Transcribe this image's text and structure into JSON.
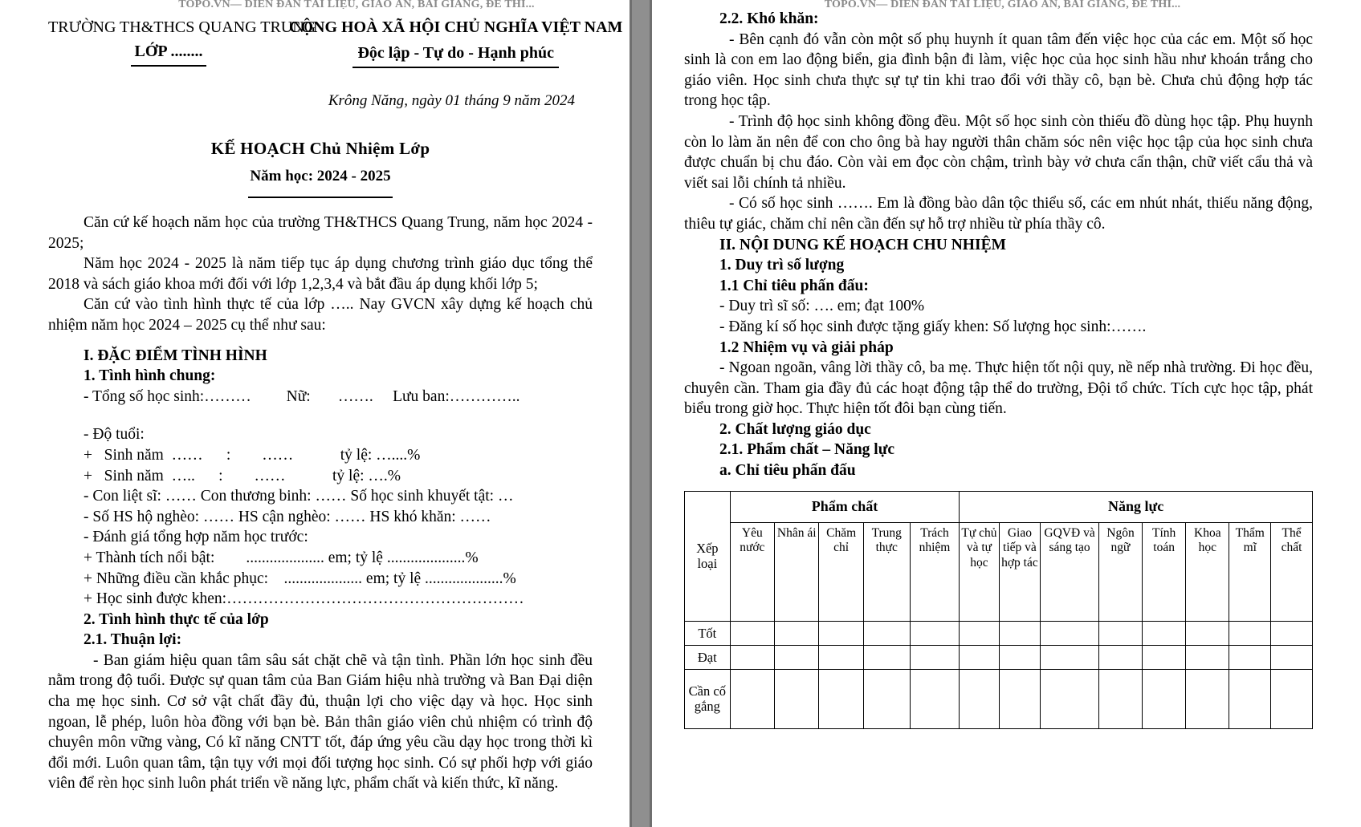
{
  "watermark": "TOPO.VN— DIỄN ĐÀN TÀI LIỆU, GIÁO ÁN, BÀI GIẢNG, ĐỀ THI...",
  "page_left": {
    "header": {
      "school": "TRƯỜNG TH&THCS QUANG TRUNG",
      "class_label": "LỚP ........",
      "national_title": "CỘNG HOÀ XÃ HỘI CHỦ NGHĨA VIỆT NAM",
      "national_motto": "Độc lập - Tự do - Hạnh phúc",
      "place_date": "Krông Năng, ngày 01 tháng 9  năm 2024",
      "doc_title": "KẾ HOẠCH Chủ Nhiệm Lớp",
      "school_year": "Năm học: 2024 - 2025"
    },
    "intro": [
      "Căn cứ kế hoạch năm học của trường TH&THCS Quang Trung, năm học 2024 - 2025;",
      "Năm học 2024 - 2025 là năm tiếp tục áp dụng chương trình giáo dục tổng thể 2018 và sách giáo khoa mới đối với lớp 1,2,3,4 và bắt đầu áp dụng khối lớp 5;",
      "Căn cứ vào tình hình thực tế của lớp ….. Nay GVCN xây dựng kế hoạch chủ nhiệm năm học 2024 – 2025 cụ thể như sau:"
    ],
    "section_1_heading": "I. ĐẶC ĐIỂM TÌNH HÌNH",
    "sub_1_heading": "1. Tình hình chung:",
    "lines": {
      "tong_so": "- Tổng số học sinh:………",
      "nu": "Nữ:",
      "nu_dots": "…….",
      "luu_ban": "Lưu ban:…………..",
      "do_tuoi": "- Độ tuổi:",
      "sinh_nam_1": "+   Sinh năm  ……      :        ……            tỷ lệ: …....%",
      "sinh_nam_2": "+   Sinh năm  …..      :        ……            tỷ lệ: ….%",
      "con_liet_si": "- Con liệt sĩ: ……   Con thương binh: …… Số học sinh khuyết tật: …",
      "ho_ngheo": "- Số HS hộ nghèo: ……         HS cận nghèo: …… HS khó khăn: ……",
      "danh_gia": "- Đánh giá tổng hợp năm học trước:",
      "thanh_tich": "+ Thành tích nổi bật:        .................... em; tỷ lệ ....................%",
      "khac_phuc": "+ Những điều cần khắc phục:    .................... em; tỷ lệ ....................%",
      "duoc_khen": "+ Học sinh được khen:…………………………………………………"
    },
    "sub_2_heading": "2. Tình hình thực tế của lớp",
    "sub_21_heading": "2.1. Thuận lợi:",
    "thuan_loi_text": "- Ban giám hiệu quan tâm sâu sát chặt chẽ và tận tình. Phần lớn học sinh đều nằm trong độ tuổi. Được sự quan tâm của Ban Giám hiệu nhà trường và Ban Đại diện cha mẹ học sinh. Cơ sở vật chất đầy đủ, thuận lợi cho việc dạy và học. Học sinh ngoan, lễ phép, luôn hòa đồng với bạn bè. Bản thân giáo viên chủ nhiệm có trình độ chuyên môn vững vàng, Có kĩ năng CNTT tốt, đáp ứng yêu cầu dạy học trong thời kì đổi mới. Luôn quan tâm, tận tụy với mọi đối tượng học sinh. Có sự phối hợp với giáo viên để rèn học sinh luôn phát triển về năng lực, phẩm chất và kiến thức, kĩ năng."
  },
  "page_right": {
    "sub_22_heading": "2.2. Khó khăn:",
    "kho_khan_1": "- Bên cạnh đó vẫn còn một số  phụ huynh ít quan tâm đến việc học của các em. Một số học sinh là con em lao động biển, gia đình bận đi làm, việc học của học sinh hầu như khoán trắng cho giáo viên. Học sinh chưa thực sự tự tin khi trao đổi với thầy cô, bạn bè. Chưa chủ động hợp tác trong học tập.",
    "kho_khan_2": "- Trình độ học sinh không đồng đều. Một số học sinh còn thiếu đồ dùng học tập. Phụ huynh còn lo làm ăn nên để con cho ông bà hay người thân chăm sóc nên việc học tập của học sinh chưa được chuẩn bị chu đáo. Còn vài em đọc còn chậm, trình bày vở chưa cẩn thận, chữ viết cẩu thả và viết sai lỗi chính tả nhiều.",
    "kho_khan_3": "- Có số học sinh ……. Em là đồng bào dân tộc thiểu số, các em nhút nhát, thiếu năng động, thiêu tự giác, chăm chỉ nên cần đến sự hỗ trợ nhiều từ phía thầy cô.",
    "section_2_heading": "II. NỘI DUNG KẾ HOẠCH CHU NHIỆM",
    "h_1": "1. Duy trì số lượng",
    "h_11": "1.1 Chỉ tiêu phấn đấu:",
    "duy_tri": "- Duy trì sĩ số:  …. em; đạt 100%",
    "dang_ki": "- Đăng kí số học sinh được tặng giấy khen: Số lượng học sinh:…….",
    "h_12": "1.2 Nhiệm vụ và giải pháp",
    "nhiem_vu_text": "- Ngoan ngoãn, vâng lời thầy cô, ba mẹ. Thực hiện tốt nội quy, nề nếp nhà trường. Đi học đều, chuyên cần. Tham gia đầy đủ các hoạt động tập thể do trường, Đội tổ chức. Tích cực học tập, phát biểu trong giờ học. Thực hiện tốt đôi bạn cùng tiến.",
    "h_2": "2. Chất lượng giáo dục",
    "h_21": "2.1. Phẩm chất – Năng lực",
    "h_21a": "a. Chỉ tiêu phấn đấu",
    "table": {
      "corner_label": "Xếp loại",
      "group_headers": [
        "Phẩm chất",
        "Năng lực"
      ],
      "pham_chat_cols": [
        "Yêu nước",
        "Nhân ái",
        "Chăm chỉ",
        "Trung thực",
        "Trách nhiệm"
      ],
      "nang_luc_cols": [
        "Tự chủ và tự học",
        "Giao tiếp và hợp tác",
        "GQVĐ và sáng tạo",
        "Ngôn ngữ",
        "Tính toán",
        "Khoa học",
        "Thẩm mĩ",
        "Thể chất"
      ],
      "rows": [
        "Tốt",
        "Đạt",
        "Cần cố gắng"
      ]
    }
  }
}
